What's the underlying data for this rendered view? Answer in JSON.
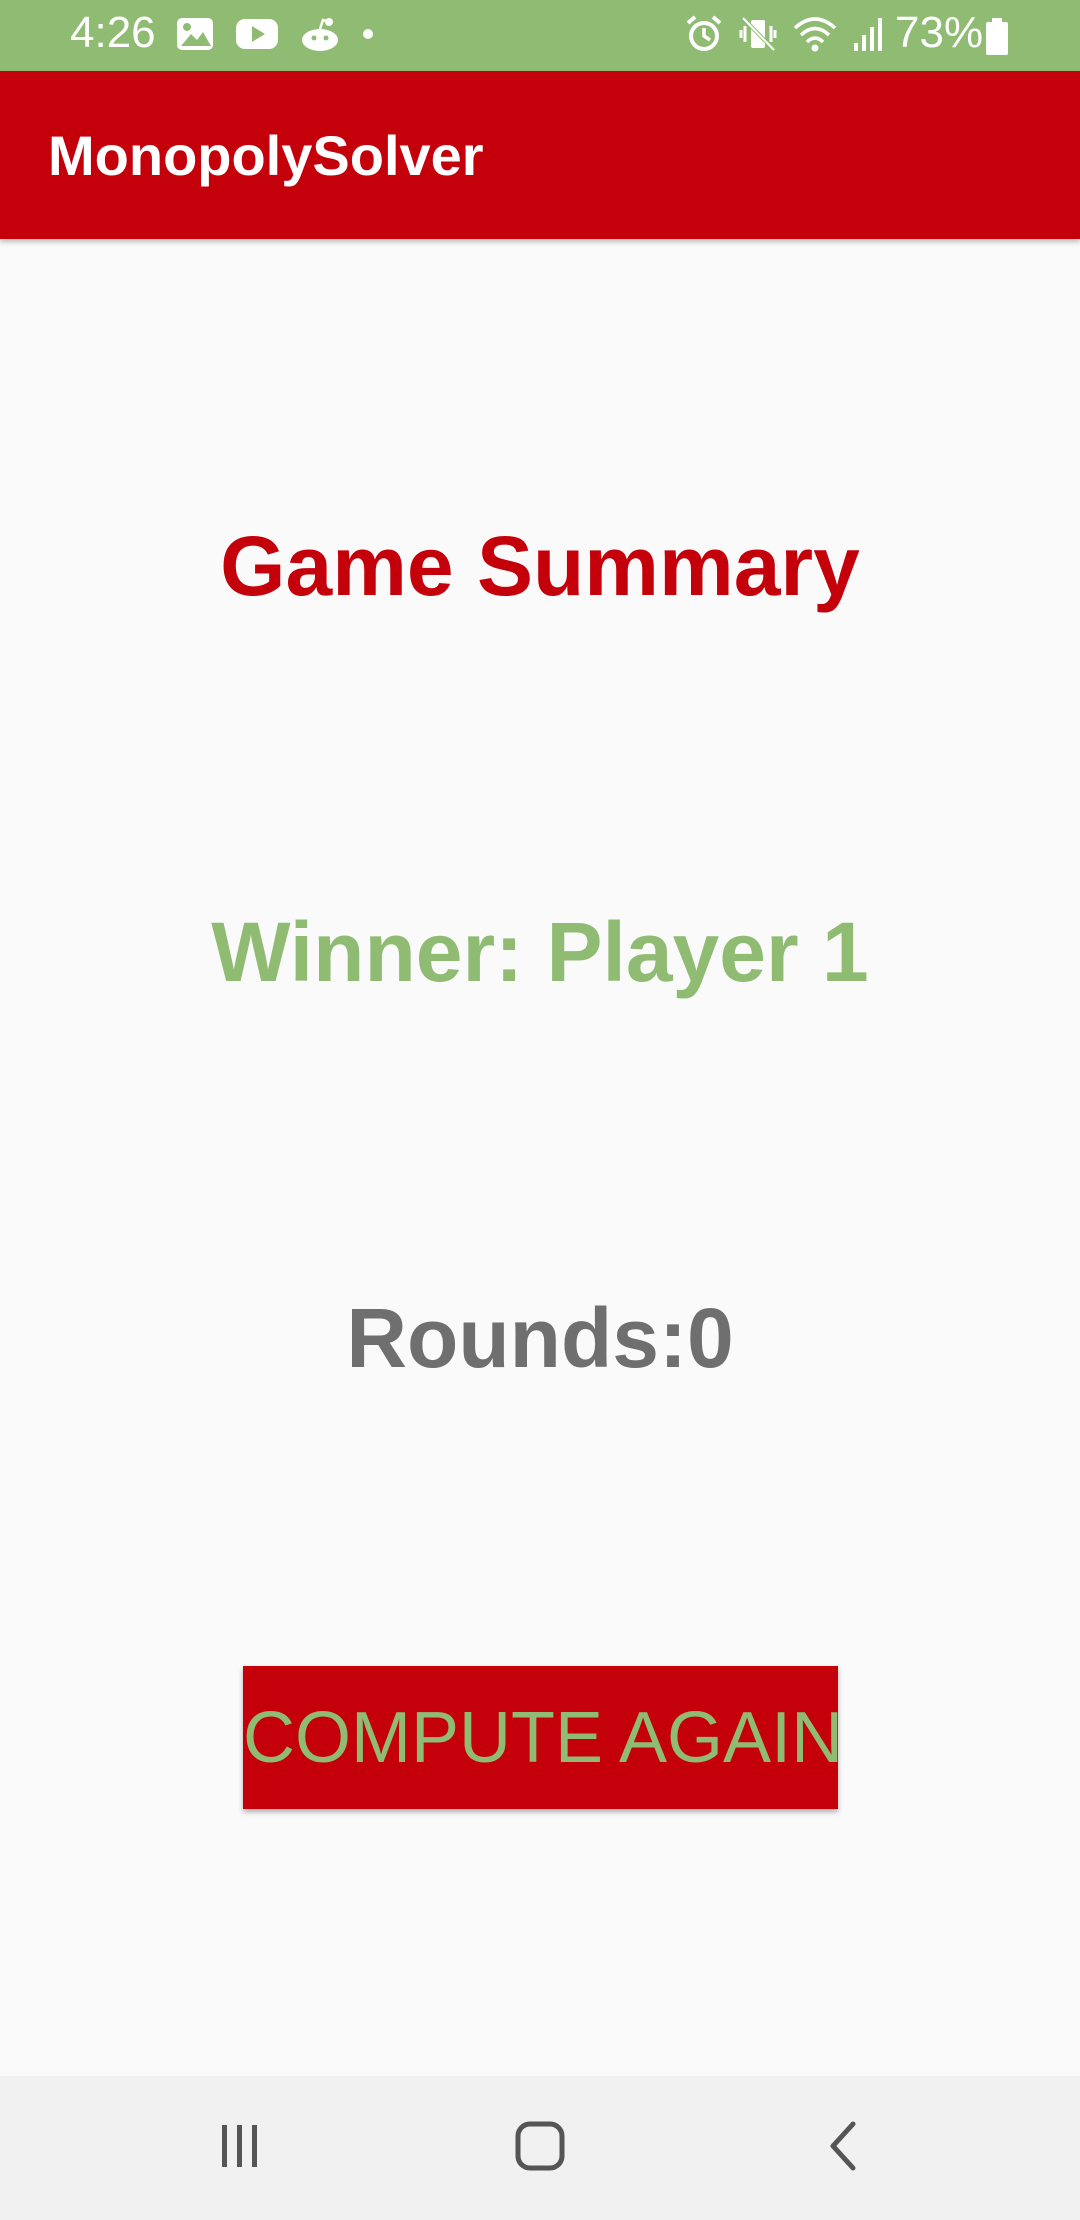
{
  "status_bar": {
    "time": "4:26",
    "battery_percent": "73%",
    "left_icons": [
      "gallery-icon",
      "youtube-icon",
      "reddit-icon",
      "dot-icon"
    ],
    "right_icons": [
      "alarm-icon",
      "vibrate-icon",
      "wifi-icon",
      "signal-icon",
      "battery-icon"
    ],
    "background_color": "#8fbc72"
  },
  "app_bar": {
    "title": "MonopolySolver",
    "background_color": "#c4000a"
  },
  "summary": {
    "title": "Game Summary",
    "winner": "Winner: Player 1",
    "rounds": "Rounds:0"
  },
  "actions": {
    "compute_again_label": "COMPUTE AGAIN"
  },
  "nav_bar": {
    "icons": [
      "recent-apps-icon",
      "home-icon",
      "back-icon"
    ]
  },
  "colors": {
    "primary_red": "#c4000a",
    "accent_green": "#8fbc72",
    "text_gray": "#6f6f6f",
    "background": "#fafafa"
  }
}
